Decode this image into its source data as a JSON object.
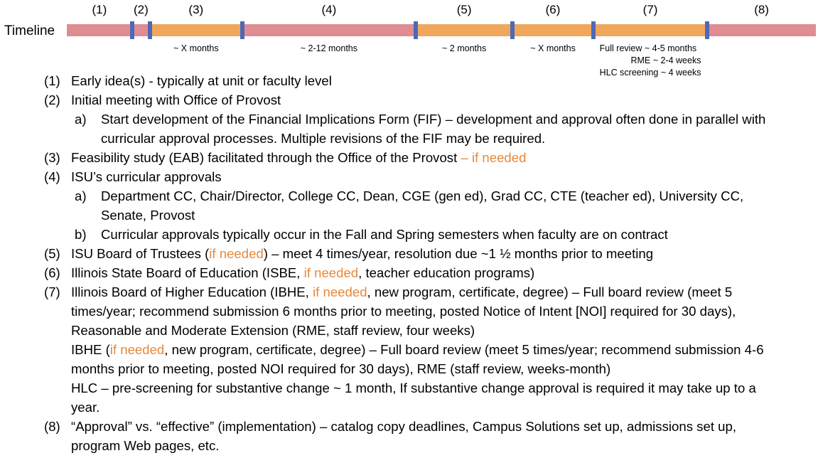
{
  "timeline": {
    "label": "Timeline",
    "colors": {
      "pink": "#E08C93",
      "orange": "#EFA75C",
      "marker_blue": "#4E68B8",
      "highlight_orange": "#E8883A"
    },
    "phases": [
      {
        "id": "(1)",
        "color": "pink",
        "start_pct": 0.0,
        "end_pct": 8.7,
        "duration": ""
      },
      {
        "id": "(2)",
        "color": "pink",
        "start_pct": 8.7,
        "end_pct": 11.1,
        "duration": ""
      },
      {
        "id": "(3)",
        "color": "orange",
        "start_pct": 11.1,
        "end_pct": 23.4,
        "duration": "~ X months"
      },
      {
        "id": "(4)",
        "color": "pink",
        "start_pct": 23.4,
        "end_pct": 46.6,
        "duration": "~ 2-12 months"
      },
      {
        "id": "(5)",
        "color": "orange",
        "start_pct": 46.6,
        "end_pct": 59.5,
        "duration": "~ 2 months"
      },
      {
        "id": "(6)",
        "color": "orange",
        "start_pct": 59.5,
        "end_pct": 70.3,
        "duration": "~ X months"
      },
      {
        "id": "(7)",
        "color": "orange",
        "start_pct": 70.3,
        "end_pct": 85.5,
        "duration_lines": [
          "Full review ~ 4-5 months",
          "RME ~ 2-4 weeks",
          "HLC screening ~ 4 weeks"
        ]
      },
      {
        "id": "(8)",
        "color": "pink",
        "start_pct": 85.5,
        "end_pct": 100.0,
        "duration": ""
      }
    ],
    "markers_pct": [
      8.7,
      11.1,
      23.4,
      46.6,
      59.5,
      70.3,
      85.5
    ]
  },
  "list": {
    "items": [
      {
        "level": 1,
        "marker": "(1)",
        "runs": [
          {
            "t": "Early idea(s) - typically at unit or faculty level"
          }
        ]
      },
      {
        "level": 1,
        "marker": "(2)",
        "runs": [
          {
            "t": "Initial meeting with Office of Provost"
          }
        ]
      },
      {
        "level": 2,
        "marker": "a)",
        "runs": [
          {
            "t": "Start development of the Financial Implications Form (FIF) – development and approval often done in parallel with curricular approval processes. Multiple revisions of the FIF may be required."
          }
        ]
      },
      {
        "level": 1,
        "marker": "(3)",
        "runs": [
          {
            "t": "Feasibility study (EAB) facilitated through the Office of the Provost "
          },
          {
            "t": "– if needed",
            "hl": true
          }
        ]
      },
      {
        "level": 1,
        "marker": "(4)",
        "runs": [
          {
            "t": "ISU’s curricular approvals"
          }
        ]
      },
      {
        "level": 2,
        "marker": "a)",
        "runs": [
          {
            "t": "Department CC, Chair/Director, College CC, Dean, CGE (gen ed), Grad CC, CTE (teacher ed), University CC, Senate, Provost"
          }
        ]
      },
      {
        "level": 2,
        "marker": "b)",
        "runs": [
          {
            "t": "Curricular approvals typically occur in the Fall and Spring semesters when faculty are on contract"
          }
        ]
      },
      {
        "level": 1,
        "marker": "(5)",
        "runs": [
          {
            "t": "ISU Board of Trustees ("
          },
          {
            "t": "if needed",
            "hl": true
          },
          {
            "t": ") – meet 4 times/year, resolution due ~1 ½ months prior to meeting"
          }
        ]
      },
      {
        "level": 1,
        "marker": "(6)",
        "runs": [
          {
            "t": "Illinois State Board of Education (ISBE, "
          },
          {
            "t": "if needed",
            "hl": true
          },
          {
            "t": ", teacher education programs)"
          }
        ]
      },
      {
        "level": 1,
        "marker": "(7)",
        "runs": [
          {
            "t": "Illinois Board of Higher Education (IBHE, "
          },
          {
            "t": "if needed",
            "hl": true
          },
          {
            "t": ", new program, certificate, degree) – Full board review (meet 5 times/year; recommend submission 6 months prior to meeting, posted Notice of Intent [NOI] required for 30 days), Reasonable and Moderate Extension (RME, staff review, four weeks)"
          }
        ],
        "continuations": [
          {
            "runs": [
              {
                "t": "IBHE ("
              },
              {
                "t": "if needed",
                "hl": true
              },
              {
                "t": ", new program, certificate, degree) – Full board review (meet 5 times/year; recommend submission 4-6 months prior to meeting, posted NOI required for 30 days), RME (staff review, weeks-month)"
              }
            ]
          },
          {
            "runs": [
              {
                "t": "HLC – pre-screening for substantive change ~ 1 month, If substantive change approval is required it may take up to a year."
              }
            ]
          }
        ]
      },
      {
        "level": 1,
        "marker": "(8)",
        "runs": [
          {
            "t": "“Approval” vs. “effective” (implementation) – catalog copy deadlines, Campus Solutions set up, admissions set up, program Web pages, etc."
          }
        ]
      }
    ]
  }
}
